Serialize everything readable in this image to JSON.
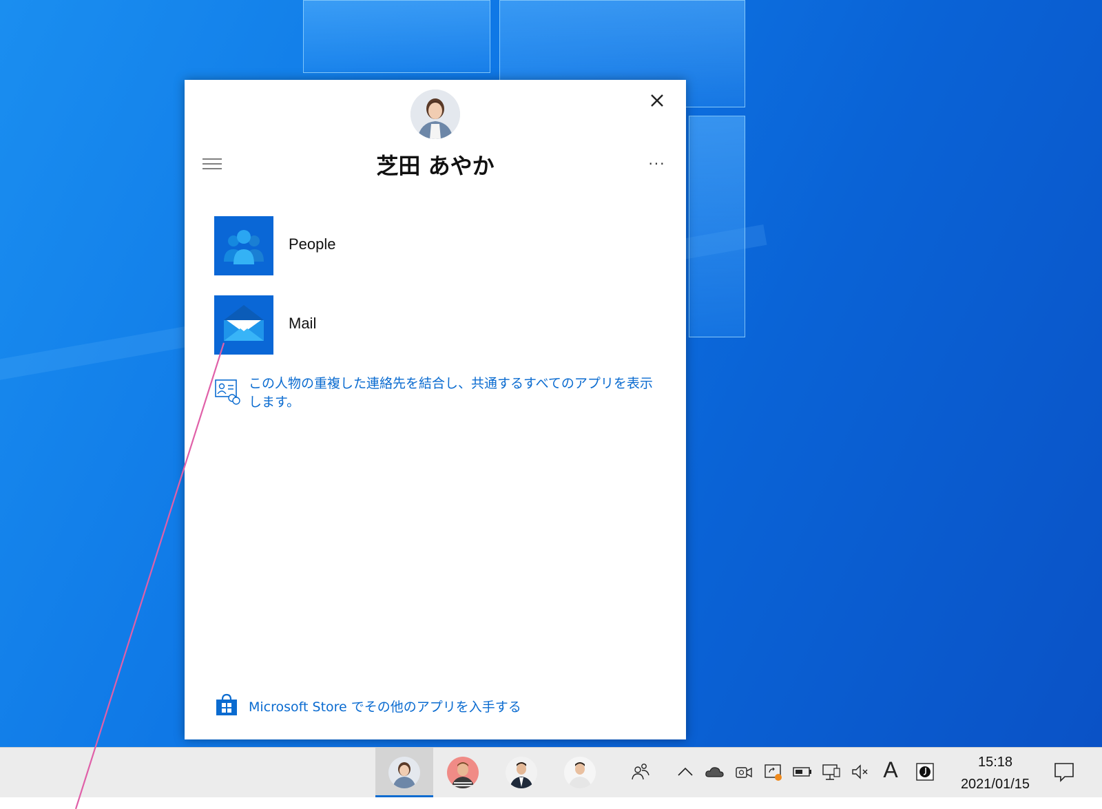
{
  "contact": {
    "name": "芝田 あやか",
    "avatar_icon": "person-photo-icon"
  },
  "header": {
    "close_icon": "close-icon",
    "menu_icon": "hamburger-menu-icon",
    "more_icon": "more-options-icon",
    "more_label": "···"
  },
  "apps": [
    {
      "label": "People",
      "icon": "people-app-icon"
    },
    {
      "label": "Mail",
      "icon": "mail-app-icon"
    }
  ],
  "merge_link": {
    "text": "この人物の重複した連絡先を結合し、共通するすべてのアプリを表示します。",
    "icon": "contact-card-link-icon"
  },
  "store_link": {
    "text": "Microsoft Store でその他のアプリを入手する",
    "icon": "store-bag-icon"
  },
  "taskbar": {
    "pinned_people": [
      {
        "icon": "pinned-contact-avatar-icon",
        "active": true
      },
      {
        "icon": "pinned-contact-avatar-icon",
        "active": false
      },
      {
        "icon": "pinned-contact-avatar-icon",
        "active": false
      },
      {
        "icon": "pinned-contact-avatar-icon",
        "active": false
      }
    ],
    "tray": {
      "people_icon": "people-taskbar-icon",
      "ime_label": "A",
      "time": "15:18",
      "date": "2021/01/15"
    }
  },
  "colors": {
    "accent": "#0a6bd0",
    "tile": "#0a67d6",
    "desktop": "#0f78e6",
    "annotation": "#e060a8"
  }
}
